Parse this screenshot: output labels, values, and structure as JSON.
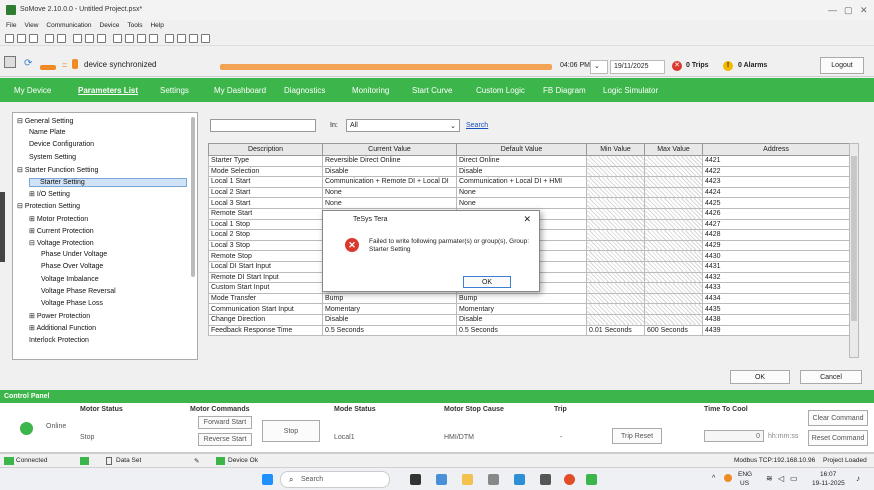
{
  "window": {
    "title": "SoMove 2.10.0.0 - Untitled Project.psx*",
    "controls": [
      "—",
      "▢",
      "✕"
    ]
  },
  "menu": [
    "File",
    "View",
    "Communication",
    "Device",
    "Tools",
    "Help"
  ],
  "status": {
    "sync_text": "device synchronized",
    "time": "04:06 PM",
    "date": "19/11/2025",
    "trips": "0 Trips",
    "alarms": "0 Alarms",
    "logout": "Logout"
  },
  "nav": [
    "My Device",
    "Parameters List",
    "Settings",
    "My Dashboard",
    "Diagnostics",
    "Monitoring",
    "Start Curve",
    "Custom Logic",
    "FB Diagram",
    "Logic Simulator"
  ],
  "tree": [
    {
      "label": "General Setting",
      "lvl": 0,
      "exp": "⊟"
    },
    {
      "label": "Name Plate",
      "lvl": 1
    },
    {
      "label": "Device Configuration",
      "lvl": 1
    },
    {
      "label": "System Setting",
      "lvl": 1
    },
    {
      "label": "Starter Function Setting",
      "lvl": 0,
      "exp": "⊟"
    },
    {
      "label": "Starter Setting",
      "lvl": 1,
      "sel": true
    },
    {
      "label": "I/O Setting",
      "lvl": 1,
      "exp": "⊞"
    },
    {
      "label": "Protection Setting",
      "lvl": 0,
      "exp": "⊟"
    },
    {
      "label": "Motor Protection",
      "lvl": 1,
      "exp": "⊞"
    },
    {
      "label": "Current Protection",
      "lvl": 1,
      "exp": "⊞"
    },
    {
      "label": "Voltage Protection",
      "lvl": 1,
      "exp": "⊟"
    },
    {
      "label": "Phase Under Voltage",
      "lvl": 2
    },
    {
      "label": "Phase Over Voltage",
      "lvl": 2
    },
    {
      "label": "Voltage Imbalance",
      "lvl": 2
    },
    {
      "label": "Voltage Phase Reversal",
      "lvl": 2
    },
    {
      "label": "Voltage Phase Loss",
      "lvl": 2
    },
    {
      "label": "Power Protection",
      "lvl": 1,
      "exp": "⊞"
    },
    {
      "label": "Additional Function",
      "lvl": 1,
      "exp": "⊞"
    },
    {
      "label": "Interlock Protection",
      "lvl": 1
    }
  ],
  "filter": {
    "in_label": "In:",
    "in_value": "All",
    "search_link": "Search"
  },
  "grid": {
    "headers": [
      "Description",
      "Current Value",
      "Default Value",
      "Min Value",
      "Max Value",
      "Address"
    ],
    "rows": [
      [
        "Starter Type",
        "Reversible Direct Online",
        "Direct Online",
        "",
        "",
        "4421"
      ],
      [
        "Mode Selection",
        "Disable",
        "Disable",
        "",
        "",
        "4422"
      ],
      [
        "Local 1 Start",
        "Communication + Remote DI + Local DI",
        "Communication + Local DI + HMI",
        "",
        "",
        "4423"
      ],
      [
        "Local 2 Start",
        "None",
        "None",
        "",
        "",
        "4424"
      ],
      [
        "Local 3 Start",
        "None",
        "None",
        "",
        "",
        "4425"
      ],
      [
        "Remote Start",
        "None",
        "",
        "",
        "",
        "4426"
      ],
      [
        "Local 1 Stop",
        "Comm",
        "DI + HMI",
        "",
        "",
        "4427"
      ],
      [
        "Local 2 Stop",
        "None",
        "",
        "",
        "",
        "4428"
      ],
      [
        "Local 3 Stop",
        "None",
        "",
        "",
        "",
        "4429"
      ],
      [
        "Remote Stop",
        "None",
        "",
        "",
        "",
        "4430"
      ],
      [
        "Local DI Start Input",
        "Momen",
        "",
        "",
        "",
        "4431"
      ],
      [
        "Remote DI Start Input",
        "Momentary",
        "Momentary",
        "",
        "",
        "4432"
      ],
      [
        "Custom Start Input",
        "Momentary",
        "Momentary",
        "",
        "",
        "4433"
      ],
      [
        "Mode Transfer",
        "Bump",
        "Bump",
        "",
        "",
        "4434"
      ],
      [
        "Communication Start Input",
        "Momentary",
        "Momentary",
        "",
        "",
        "4435"
      ],
      [
        "Change Direction",
        "Disable",
        "Disable",
        "",
        "",
        "4438"
      ],
      [
        "Feedback Response Time",
        "0.5 Seconds",
        "0.5 Seconds",
        "0.01 Seconds",
        "600 Seconds",
        "4439"
      ]
    ]
  },
  "dialog": {
    "title": "TeSys Tera",
    "message": "Failed to write following parmater(s) or group(s), Group: Starter Setting",
    "ok": "OK"
  },
  "buttons": {
    "ok": "OK",
    "cancel": "Cancel"
  },
  "control_panel": {
    "title": "Control Panel",
    "motor_status": "Motor Status",
    "online": "Online",
    "stop_val": "Stop",
    "motor_commands": "Motor Commands",
    "forward_start": "Forward Start",
    "reverse_start": "Reverse Start",
    "stop_btn": "Stop",
    "mode_status": "Mode Status",
    "mode_val": "Local1",
    "stop_cause": "Motor Stop Cause",
    "stop_cause_val": "HMI/DTM",
    "trip": "Trip",
    "trip_val": "-",
    "trip_reset": "Trip Reset",
    "time_to_cool": "Time To Cool",
    "cool_val": "0",
    "cool_unit": "hh:mm:ss",
    "clear_command": "Clear Command",
    "reset_command": "Reset Command"
  },
  "statusbar": {
    "connected": "Connected",
    "dataset": "Data Set",
    "device": "Device Ok",
    "modbus": "Modbus TCP:192.168.10.96",
    "project": "Project Loaded"
  },
  "taskbar": {
    "search": "Search",
    "lang": "ENG",
    "region": "US",
    "time": "16:07",
    "date": "19-11-2025"
  },
  "colors": {
    "green": "#3cb54a",
    "orange": "#f2a354",
    "error": "#d9382e"
  }
}
